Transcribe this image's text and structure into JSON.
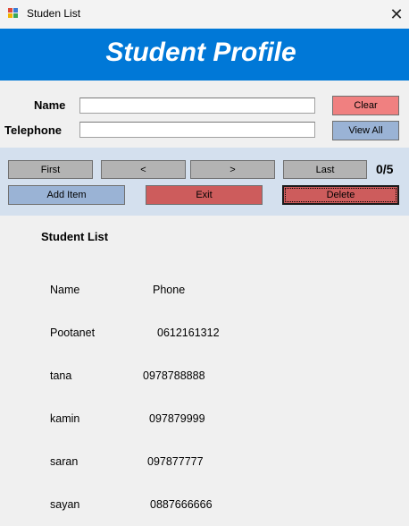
{
  "window": {
    "title": "Studen List",
    "close_glyph": "✕"
  },
  "header": {
    "title": "Student Profile",
    "color": "#0078d7"
  },
  "form": {
    "name_label": "Name",
    "name_value": "",
    "phone_label": "Telephone",
    "phone_value": "",
    "clear_label": "Clear",
    "view_all_label": "View All"
  },
  "nav": {
    "first_label": "First",
    "prev_label": "<",
    "next_label": ">",
    "last_label": "Last",
    "counter": "0/5",
    "add_label": "Add Item",
    "exit_label": "Exit",
    "delete_label": "Delete"
  },
  "list": {
    "heading": "Student List",
    "col_name": "Name",
    "col_phone": "Phone",
    "rows": [
      {
        "name": "Pootanet",
        "phone": "0612161312"
      },
      {
        "name": "tana",
        "phone": "0978788888"
      },
      {
        "name": "kamin",
        "phone": "097879999"
      },
      {
        "name": "saran",
        "phone": "097877777"
      },
      {
        "name": "sayan",
        "phone": "0887666666"
      }
    ]
  },
  "colors": {
    "clear": "#f08080",
    "view_all": "#9ab3d5",
    "nav_gray": "#b3b3b3",
    "exit": "#cd5c5c",
    "panel": "#d4e0ee"
  }
}
